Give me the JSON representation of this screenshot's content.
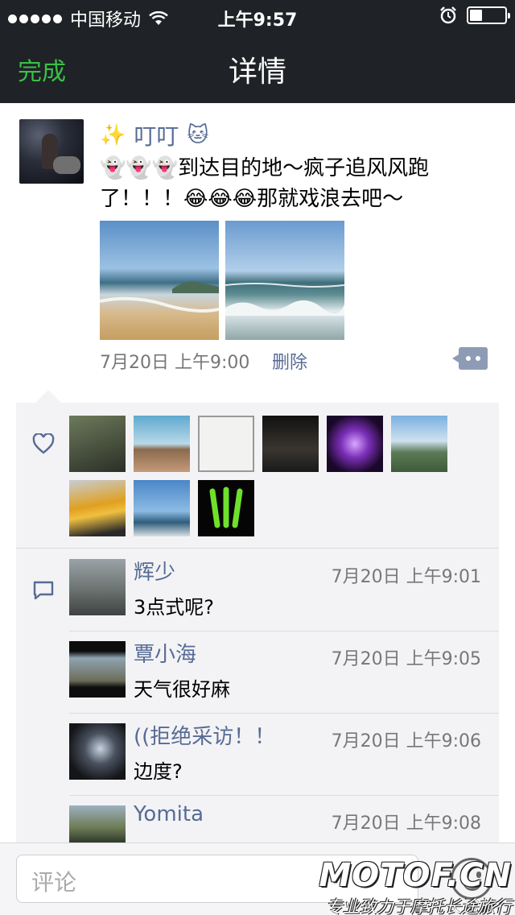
{
  "status_bar": {
    "carrier": "中国移动",
    "time": "上午9:57",
    "battery_level": 0.35
  },
  "nav": {
    "done_label": "完成",
    "title": "详情"
  },
  "post": {
    "author": "叮叮",
    "author_prefix_emoji": "✨",
    "author_suffix_emoji": "🐱",
    "content": "👻👻👻到达目的地～疯子追风风跑了！！！😂😂😂那就戏浪去吧～",
    "timestamp": "7月20日 上午9:00",
    "delete_label": "删除"
  },
  "likes": {
    "icon": "heart-icon",
    "avatar_count": 9
  },
  "comments": [
    {
      "name": "辉少",
      "time": "7月20日 上午9:01",
      "text": "3点式呢?"
    },
    {
      "name": "覃小海",
      "time": "7月20日 上午9:05",
      "text": "天气很好麻"
    },
    {
      "name": "((拒绝采访！！",
      "time": "7月20日 上午9:06",
      "text": "边度?"
    },
    {
      "name": "Yomita",
      "time": "7月20日 上午9:08",
      "text": ""
    }
  ],
  "input": {
    "placeholder": "评论"
  },
  "watermark": {
    "logo": "MOTOF.CN",
    "tagline": "专业致力于摩托长途旅行"
  },
  "colors": {
    "nav_bg": "#1f2226",
    "accent_green": "#3ac047",
    "link_blue": "#576b95"
  }
}
